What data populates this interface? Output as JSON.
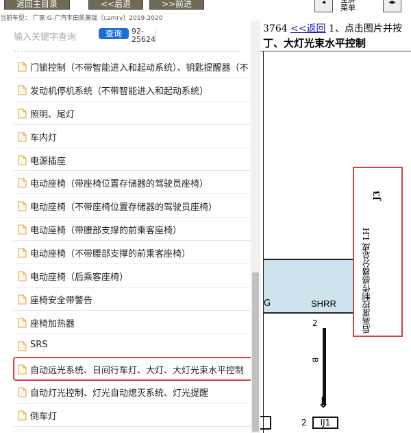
{
  "toolbar": {
    "back_home": "返回主目录",
    "prev": "<<后退",
    "next": ">>前进",
    "full_menu": "全屏\n菜单",
    "model_line": "当前车型： 厂家:G-广汽丰田凯美瑞（camry）2019-2020"
  },
  "search": {
    "placeholder": "输入关键字查询",
    "button": "查询",
    "range": "92-\n25624"
  },
  "list": {
    "items": [
      "门锁控制（不带智能进入和起动系统）、钥匙提醒器（不",
      "发动机停机系统（不带智能进入和起动系统）",
      "照明、尾灯",
      "车内灯",
      "电源插座",
      "电动座椅（带座椅位置存储器的驾驶员座椅）",
      "电动座椅（不带座椅位置存储器的驾驶员座椅）",
      "电动座椅（带腰部支撑的前乘客座椅）",
      "电动座椅（不带腰部支撑的前乘客座椅）",
      "电动座椅（后乘客座椅）",
      "座椅安全带警告",
      "座椅加热器",
      "SRS",
      "自动远光系统、日间行车灯、大灯、大灯光束水平控制",
      "自动灯光控制、灯光自动熄灭系统、灯光提醒",
      "倒车灯"
    ],
    "highlighted_index": 13
  },
  "diagram": {
    "page_num": "3764",
    "back_link": "<<返回",
    "hint": "1、点击图片并按",
    "title": "丁、大灯光束水平控制",
    "connector_left": "G",
    "connector_right": "SHRR",
    "pin_top": "2",
    "wire_color": "B",
    "pin_bottom": "2",
    "junction": "IJ1",
    "j3_label": "后高度控制传感器分总成 LH",
    "j3_code": "J3",
    "highlight_color": "#e23b3b"
  }
}
